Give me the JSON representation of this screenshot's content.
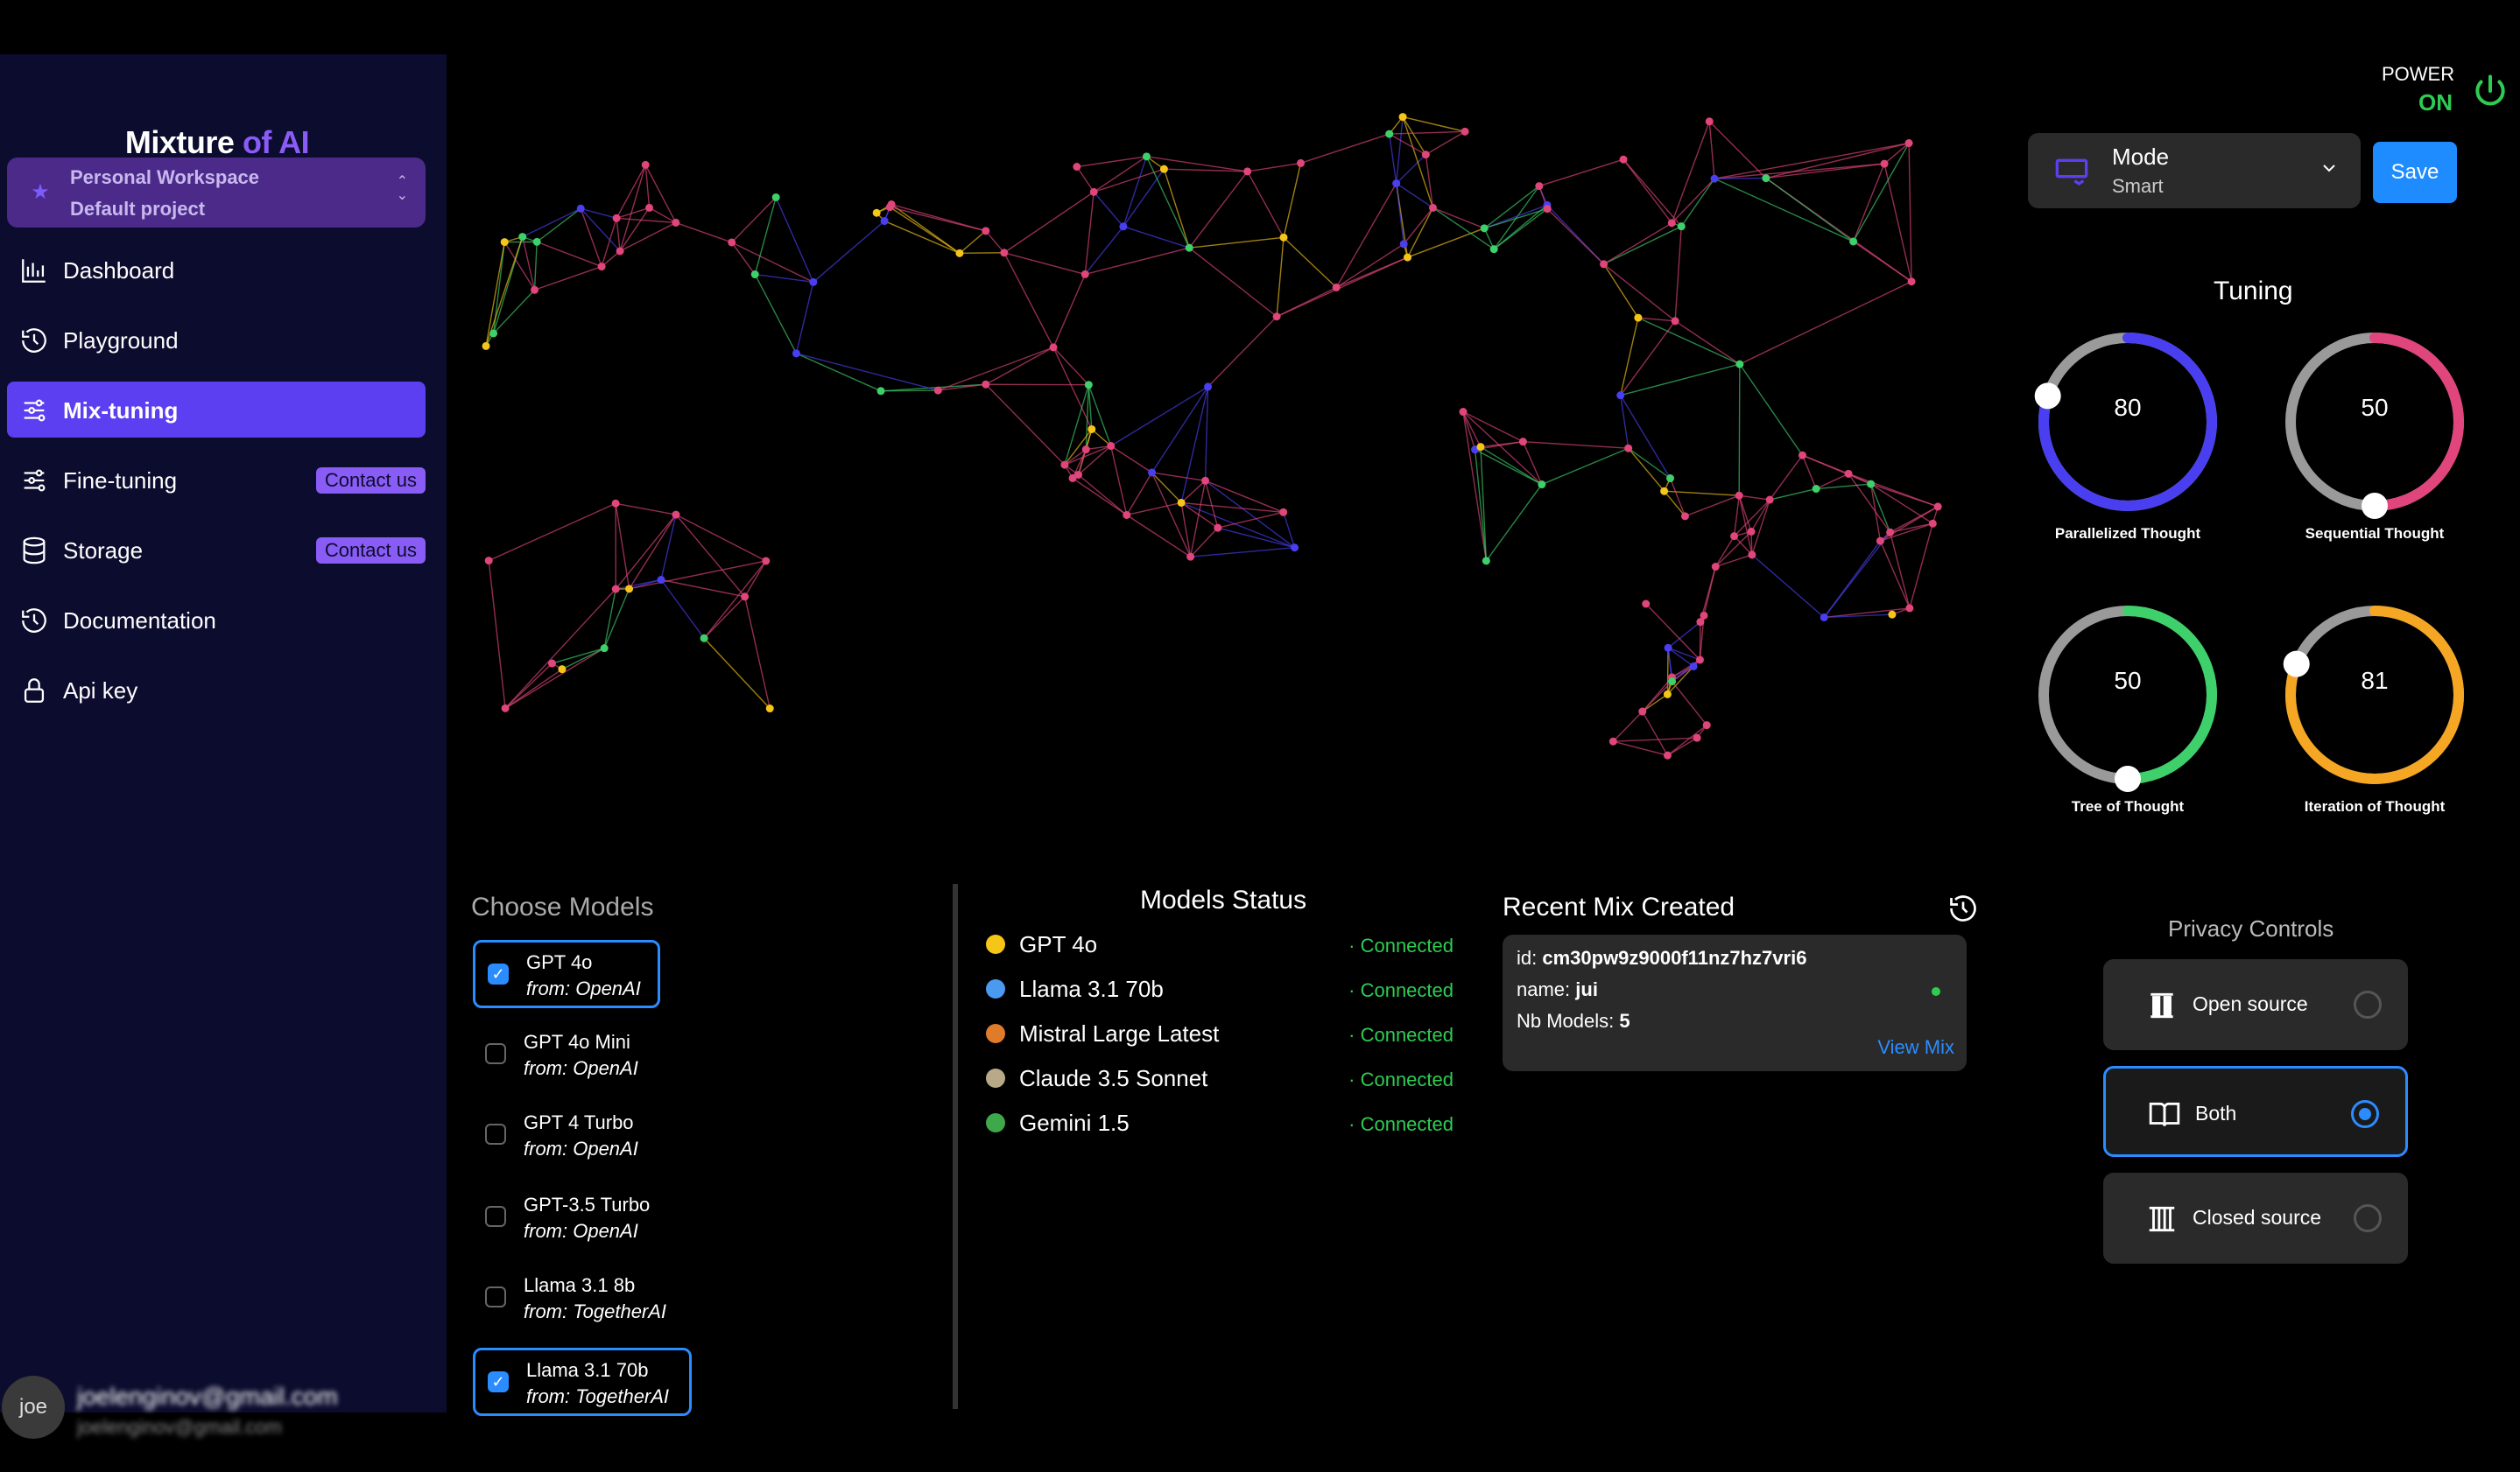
{
  "app": {
    "brand_word1": "Mixture",
    "brand_word2": "of AI",
    "accent": "#5b3ff0",
    "brand_accent": "#8a5cf6"
  },
  "workspace": {
    "name": "Personal Workspace",
    "project": "Default project"
  },
  "nav": [
    {
      "label": "Dashboard",
      "icon": "bar-chart-icon"
    },
    {
      "label": "Playground",
      "icon": "history-icon"
    },
    {
      "label": "Mix-tuning",
      "icon": "sliders-icon",
      "active": true
    },
    {
      "label": "Fine-tuning",
      "icon": "sliders-icon",
      "badge": "Contact us"
    },
    {
      "label": "Storage",
      "icon": "database-icon",
      "badge": "Contact us"
    },
    {
      "label": "Documentation",
      "icon": "history-icon"
    },
    {
      "label": "Api key",
      "icon": "lock-icon"
    }
  ],
  "user": {
    "avatar": "joe",
    "email": "joelenginov@gmail.com",
    "email_secondary": "joelenginov@gmail.com"
  },
  "power": {
    "label": "POWER",
    "state": "ON"
  },
  "mode": {
    "label": "Mode",
    "value": "Smart"
  },
  "save_label": "Save",
  "tuning": {
    "title": "Tuning",
    "dials": [
      {
        "label": "Parallelized Thought",
        "value": 80,
        "color": "#4a3ff0"
      },
      {
        "label": "Sequential Thought",
        "value": 50,
        "color": "#e0457b"
      },
      {
        "label": "Tree of Thought",
        "value": 50,
        "color": "#3ed06a"
      },
      {
        "label": "Iteration of Thought",
        "value": 81,
        "color": "#f5a623"
      }
    ]
  },
  "choose_models": {
    "title": "Choose Models",
    "items": [
      {
        "name": "GPT 4o",
        "from": "from: OpenAI",
        "checked": true
      },
      {
        "name": "GPT 4o Mini",
        "from": "from: OpenAI",
        "checked": false
      },
      {
        "name": "GPT 4 Turbo",
        "from": "from: OpenAI",
        "checked": false
      },
      {
        "name": "GPT-3.5 Turbo",
        "from": "from: OpenAI",
        "checked": false
      },
      {
        "name": "Llama 3.1 8b",
        "from": "from: TogetherAI",
        "checked": false
      },
      {
        "name": "Llama 3.1 70b",
        "from": "from: TogetherAI",
        "checked": true
      }
    ]
  },
  "models_status": {
    "title": "Models Status",
    "items": [
      {
        "name": "GPT 4o",
        "status": "· Connected",
        "color": "#f5c518"
      },
      {
        "name": "Llama 3.1 70b",
        "status": "· Connected",
        "color": "#4a9bf0"
      },
      {
        "name": "Mistral Large Latest",
        "status": "· Connected",
        "color": "#e07b2a"
      },
      {
        "name": "Claude 3.5 Sonnet",
        "status": "· Connected",
        "color": "#b8aa88"
      },
      {
        "name": "Gemini 1.5",
        "status": "· Connected",
        "color": "#3ea84a"
      }
    ]
  },
  "recent_mix": {
    "title": "Recent Mix Created",
    "id_label": "id: ",
    "id": "cm30pw9z9000f11nz7hz7vri6",
    "name_label": "name: ",
    "name": "jui",
    "nb_label": "Nb Models: ",
    "nb": "5",
    "view_label": "View Mix"
  },
  "privacy": {
    "title": "Privacy Controls",
    "options": [
      {
        "label": "Open source",
        "selected": false
      },
      {
        "label": "Both",
        "selected": true
      },
      {
        "label": "Closed source",
        "selected": false
      }
    ]
  }
}
